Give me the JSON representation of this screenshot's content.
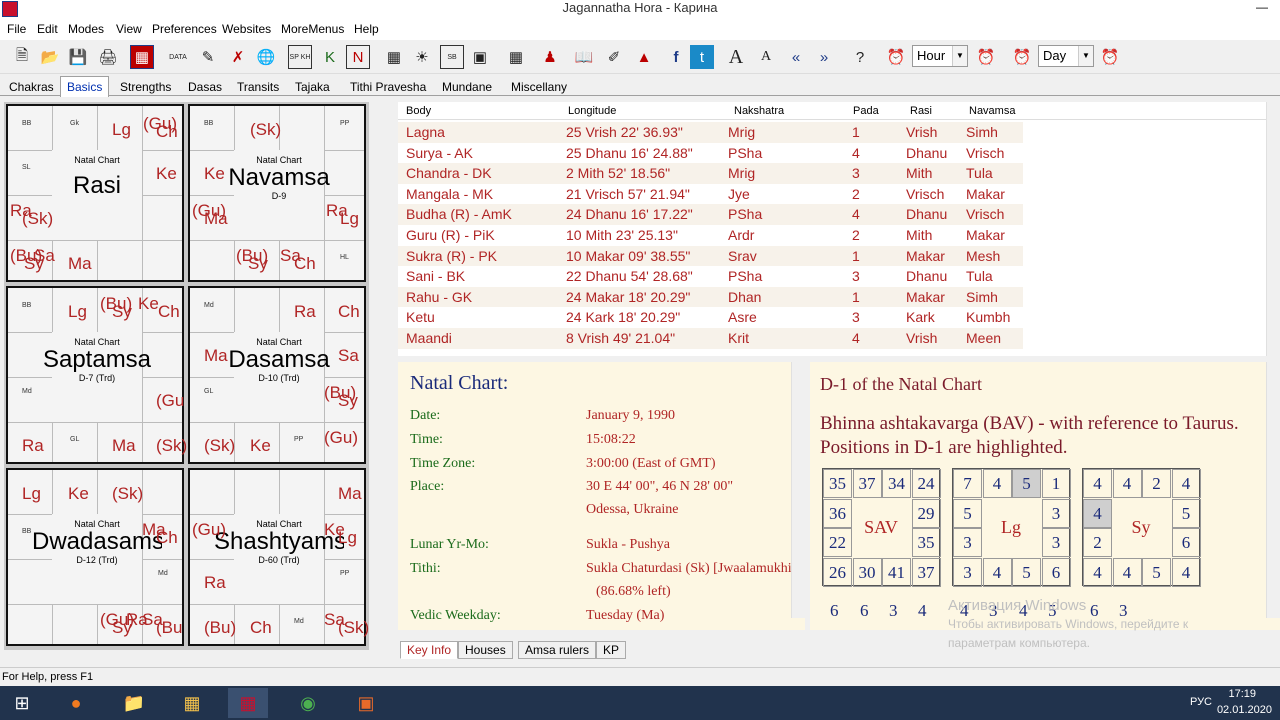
{
  "window": {
    "title": "Jagannatha Hora - Карина"
  },
  "menu": [
    "File",
    "Edit",
    "Modes",
    "View",
    "Preferences",
    "Websites",
    "MoreMenus",
    "Help"
  ],
  "toolbar": {
    "hour_combo": "Hour",
    "day_combo": "Day",
    "data_label": "DATA",
    "sp_label": "SP KH",
    "sb_label": "SB"
  },
  "tabs": [
    "Chakras",
    "Basics",
    "Strengths",
    "Dasas",
    "Transits",
    "Tajaka",
    "Tithi Pravesha",
    "Mundane",
    "Miscellany"
  ],
  "charts": {
    "natal_label": "Natal Chart",
    "rasi": {
      "name": "Rasi"
    },
    "navamsa": {
      "name": "Navamsa",
      "sub": "D-9"
    },
    "saptamsa": {
      "name": "Saptamsa",
      "sub": "D-7 (Trd)"
    },
    "dasamsa": {
      "name": "Dasamsa",
      "sub": "D-10 (Trd)"
    },
    "dwadasamsa": {
      "name": "Dwadasamsa",
      "sub": "D-12 (Trd)"
    },
    "shashtyamsa": {
      "name": "Shashtyamsa",
      "sub": "D-60 (Trd)"
    }
  },
  "table": {
    "headers": [
      "Body",
      "Longitude",
      "Nakshatra",
      "Pada",
      "Rasi",
      "Navamsa"
    ],
    "rows": [
      [
        "Lagna",
        "25 Vrish 22' 36.93\"",
        "Mrig",
        "1",
        "Vrish",
        "Simh"
      ],
      [
        "Surya - AK",
        "25 Dhanu 16' 24.88\"",
        "PSha",
        "4",
        "Dhanu",
        "Vrisch"
      ],
      [
        "Chandra - DK",
        "2 Mith 52' 18.56\"",
        "Mrig",
        "3",
        "Mith",
        "Tula"
      ],
      [
        "Mangala - MK",
        "21 Vrisch 57' 21.94\"",
        "Jye",
        "2",
        "Vrisch",
        "Makar"
      ],
      [
        "Budha (R) - AmK",
        "24 Dhanu 16' 17.22\"",
        "PSha",
        "4",
        "Dhanu",
        "Vrisch"
      ],
      [
        "Guru (R) - PiK",
        "10 Mith 23' 25.13\"",
        "Ardr",
        "2",
        "Mith",
        "Makar"
      ],
      [
        "Sukra (R) - PK",
        "10 Makar 09' 38.55\"",
        "Srav",
        "1",
        "Makar",
        "Mesh"
      ],
      [
        "Sani - BK",
        "22 Dhanu 54' 28.68\"",
        "PSha",
        "3",
        "Dhanu",
        "Tula"
      ],
      [
        "Rahu - GK",
        "24 Makar 18' 20.29\"",
        "Dhan",
        "1",
        "Makar",
        "Simh"
      ],
      [
        "Ketu",
        "24 Kark 18' 20.29\"",
        "Asre",
        "3",
        "Kark",
        "Kumbh"
      ],
      [
        "Maandi",
        "8 Vrish 49' 21.04\"",
        "Krit",
        "4",
        "Vrish",
        "Meen"
      ]
    ]
  },
  "info": {
    "title": "Natal Chart:",
    "date_label": "Date:",
    "date": "January 9, 1990",
    "time_label": "Time:",
    "time": "15:08:22",
    "tz_label": "Time Zone:",
    "tz": "3:00:00 (East of GMT)",
    "place_label": "Place:",
    "place1": "30 E 44' 00\", 46 N 28' 00\"",
    "place2": "Odessa, Ukraine",
    "lunar_label": "Lunar Yr-Mo:",
    "lunar": "Sukla - Pushya",
    "tithi_label": "Tithi:",
    "tithi": "Sukla Chaturdasi (Sk) [Jwaalamukhi]",
    "tithi2": "(86.68% left)",
    "weekday_label": "Vedic Weekday:",
    "weekday": "Tuesday (Ma)"
  },
  "bav": {
    "heading": "D-1 of the Natal Chart",
    "line1": "Bhinna ashtakavarga (BAV) - with reference to Taurus.",
    "line2": "Positions in D-1 are highlighted.",
    "grids": [
      {
        "label": "SAV",
        "cells": [
          "35",
          "37",
          "34",
          "24",
          "29",
          "35",
          "37",
          "41",
          "30",
          "26",
          "22",
          "36"
        ]
      },
      {
        "label": "Lg",
        "cells": [
          "7",
          "4",
          "5",
          "1",
          "3",
          "3",
          "6",
          "5",
          "4",
          "3",
          "3",
          "5"
        ]
      },
      {
        "label": "Sy",
        "cells": [
          "4",
          "4",
          "2",
          "4",
          "5",
          "6",
          "4",
          "5",
          "4",
          "4",
          "2",
          "4"
        ]
      }
    ],
    "partial_row": [
      "6",
      "6",
      "3",
      "4",
      "4",
      "3",
      "4",
      "5",
      "6",
      "3"
    ]
  },
  "bottom_tabs": [
    "Key Info",
    "Houses",
    "Amsa rulers",
    "KP"
  ],
  "status": "For Help, press F1",
  "watermark": {
    "line1": "Активация Windows",
    "line2": "Чтобы активировать Windows, перейдите к",
    "line3": "параметрам компьютера."
  },
  "taskbar": {
    "lang": "РУС",
    "time": "17:19",
    "date": "02.01.2020"
  }
}
